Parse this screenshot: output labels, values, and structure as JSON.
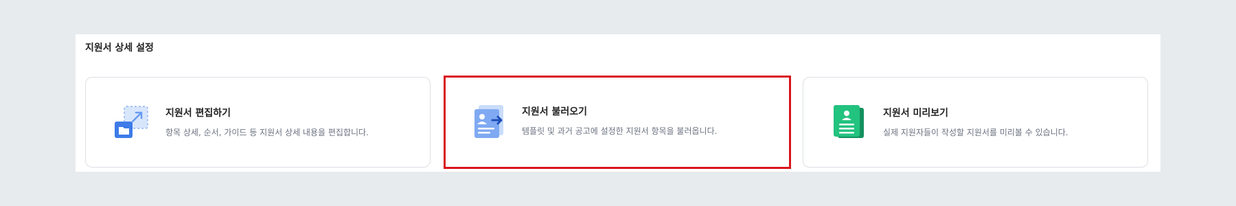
{
  "section": {
    "title": "지원서 상세 설정"
  },
  "cards": [
    {
      "title": "지원서 편집하기",
      "description": "항목 상세, 순서, 가이드 등 지원서 상세 내용을 편집합니다.",
      "icon": "edit-resize-icon",
      "accent": "#4a86f0"
    },
    {
      "title": "지원서 불러오기",
      "description": "템플릿 및 과거 공고에 설정한 지원서 항목을 불러옵니다.",
      "icon": "import-document-icon",
      "accent": "#6aa0f2"
    },
    {
      "title": "지원서 미리보기",
      "description": "실제 지원자들이 작성할 지원서를 미리볼 수 있습니다.",
      "icon": "preview-document-icon",
      "accent": "#1fb57a"
    }
  ],
  "colors": {
    "background": "#e8ebee",
    "panel": "#ffffff",
    "card_border": "#dcdfe3",
    "highlight_border": "#d9141c"
  }
}
